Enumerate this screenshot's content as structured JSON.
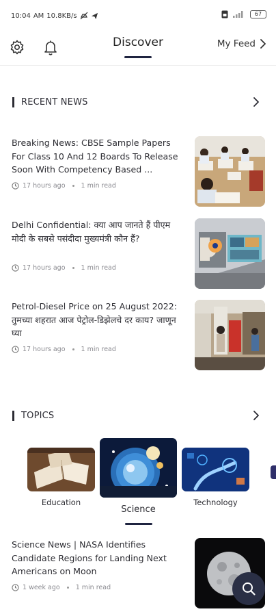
{
  "status": {
    "time": "10:04",
    "ampm": "AM",
    "speed": "10.8KB/s",
    "battery": "67"
  },
  "header": {
    "title": "Discover",
    "myfeed_label": "My Feed"
  },
  "recent_news": {
    "title": "RECENT NEWS",
    "items": [
      {
        "title": "Breaking News: CBSE Sample Papers For Class 10 And 12 Boards To Release Soon With Competency Based ...",
        "time": "17 hours ago",
        "read": "1 min read"
      },
      {
        "title": "Delhi Confidential: क्या आप जानते हैं पीएम मोदी के सबसे पसंदीदा मुख्यमंत्री कौन हैं?",
        "time": "17 hours ago",
        "read": "1 min read"
      },
      {
        "title": "Petrol-Diesel Price on 25 August 2022: तुमच्या शहरात आज पेट्रोल-डिझेलचे दर काय? जाणून घ्या",
        "time": "17 hours ago",
        "read": "1 min read"
      }
    ]
  },
  "topics": {
    "title": "TOPICS",
    "items": [
      {
        "label": "Education"
      },
      {
        "label": "Science"
      },
      {
        "label": "Technology"
      }
    ]
  },
  "topic_news": {
    "title": "Science News | NASA Identifies Candidate Regions for Landing Next Americans on Moon",
    "time": "1 week ago",
    "read": "1 min read"
  }
}
